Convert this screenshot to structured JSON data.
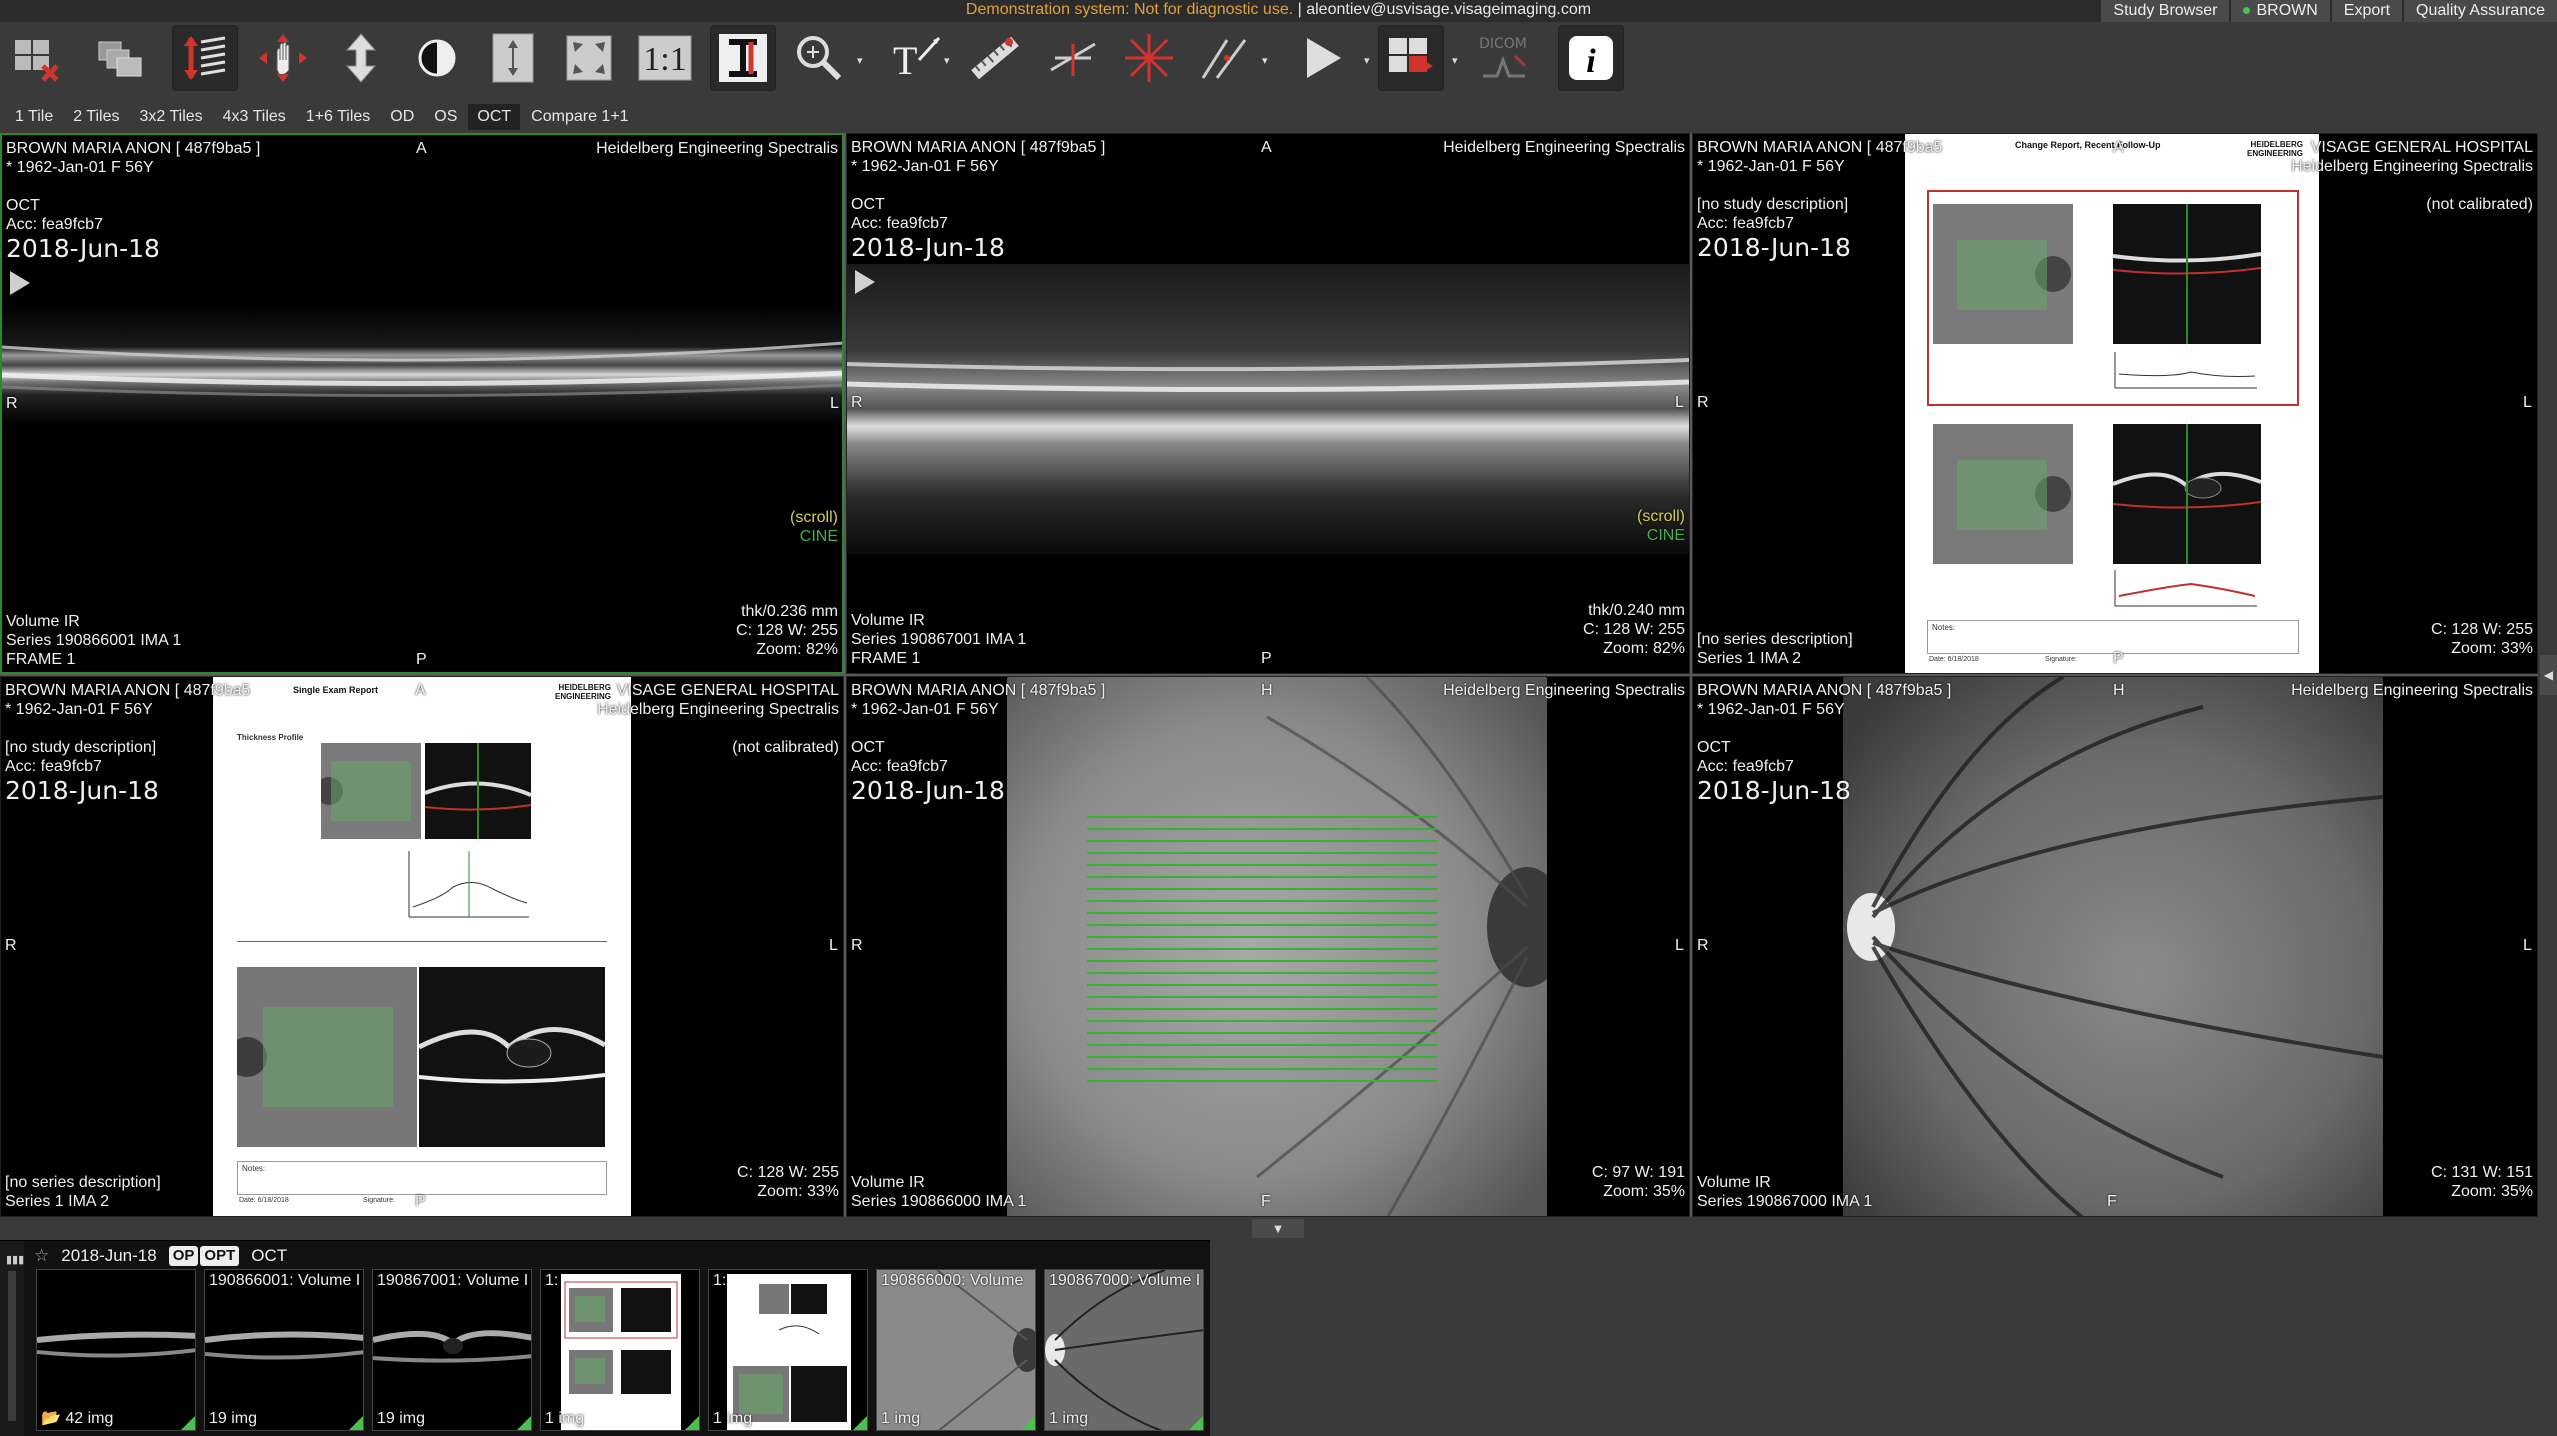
{
  "topbar": {
    "demo_notice": "Demonstration system: Not for diagnostic use.",
    "separator": " | ",
    "user_email": "aleontiev@usvisage.visageimaging.com",
    "menu": [
      "Study Browser",
      "BROWN",
      "Export",
      "Quality Assurance"
    ]
  },
  "toolbar": {
    "tools": [
      "layout-clear-icon",
      "series-stack-icon",
      "scroll-stack-icon",
      "pan-icon",
      "zoom-arrows-icon",
      "window-level-icon",
      "fit-vertical-icon",
      "fit-expand-icon",
      "one-to-one-icon",
      "invert-icon",
      "magnifier-icon",
      "annotation-text-icon",
      "ruler-icon",
      "angle-icon",
      "crosshair-icon",
      "line-tool-icon",
      "cine-play-icon",
      "hanging-protocol-icon",
      "dicom-icon",
      "info-icon"
    ],
    "one_to_one_label": "1:1",
    "dicom_label": "DICOM",
    "info_label": "i"
  },
  "layouts": [
    "1 Tile",
    "2 Tiles",
    "3x2 Tiles",
    "4x3 Tiles",
    "1+6 Tiles",
    "OD",
    "OS",
    "OCT",
    "Compare 1+1"
  ],
  "active_layout": "OCT",
  "viewports": [
    {
      "patient": "BROWN MARIA ANON [ 487f9ba5 ]",
      "dob": "* 1962-Jan-01 F 56Y",
      "orientation_top": "A",
      "device": "Heidelberg Engineering Spectralis",
      "modality": "OCT",
      "acc": "Acc: fea9fcb7",
      "date": "2018-Jun-18",
      "left": "R",
      "right": "L",
      "bottom_marker": "P",
      "scroll": "(scroll)",
      "cine": "CINE",
      "thickness": "thk/0.236 mm",
      "window": "C: 128 W: 255",
      "zoom": "Zoom: 82%",
      "series_desc": "Volume IR",
      "series": "Series 190866001 IMA 1",
      "frame": "FRAME 1"
    },
    {
      "patient": "BROWN MARIA ANON [ 487f9ba5 ]",
      "dob": "* 1962-Jan-01 F 56Y",
      "orientation_top": "A",
      "device": "Heidelberg Engineering Spectralis",
      "modality": "OCT",
      "acc": "Acc: fea9fcb7",
      "date": "2018-Jun-18",
      "left": "R",
      "right": "L",
      "bottom_marker": "P",
      "scroll": "(scroll)",
      "cine": "CINE",
      "thickness": "thk/0.240 mm",
      "window": "C: 128 W: 255",
      "zoom": "Zoom: 82%",
      "series_desc": "Volume IR",
      "series": "Series 190867001 IMA 1",
      "frame": "FRAME 1"
    },
    {
      "patient": "BROWN MARIA ANON [ 487f9ba5",
      "dob": "* 1962-Jan-01 F 56Y",
      "orientation_top": "A",
      "institution": "VISAGE GENERAL HOSPITAL",
      "device": "Heidelberg Engineering Spectralis",
      "calibration": "(not calibrated)",
      "study_desc": "[no study description]",
      "acc": "Acc: fea9fcb7",
      "date": "2018-Jun-18",
      "left": "R",
      "right": "L",
      "bottom_marker": "P",
      "window": "C: 128 W: 255",
      "zoom": "Zoom: 33%",
      "series_desc": "[no series description]",
      "series": "Series 1 IMA 2",
      "report_title": "Change Report, Recent Follow-Up",
      "report_brand": "HEIDELBERG ENGINEERING",
      "report_notes": "Notes:",
      "report_date": "Date: 6/18/2018",
      "report_signature": "Signature:"
    },
    {
      "patient": "BROWN MARIA ANON [ 487f9ba5",
      "dob": "* 1962-Jan-01 F 56Y",
      "orientation_top": "A",
      "institution": "VISAGE GENERAL HOSPITAL",
      "device": "Heidelberg Engineering Spectralis",
      "calibration": "(not calibrated)",
      "study_desc": "[no study description]",
      "acc": "Acc: fea9fcb7",
      "date": "2018-Jun-18",
      "left": "R",
      "right": "L",
      "bottom_marker": "P",
      "window": "C: 128 W: 255",
      "zoom": "Zoom: 33%",
      "series_desc": "[no series description]",
      "series": "Series 1 IMA 2",
      "report_title": "Single Exam Report",
      "report_brand": "HEIDELBERG ENGINEERING",
      "report_section": "Thickness Profile",
      "report_notes": "Notes:",
      "report_date": "Date: 6/18/2018",
      "report_signature": "Signature:"
    },
    {
      "patient": "BROWN MARIA ANON [ 487f9ba5 ]",
      "dob": "* 1962-Jan-01 F 56Y",
      "orientation_top": "H",
      "device": "Heidelberg Engineering Spectralis",
      "modality": "OCT",
      "acc": "Acc: fea9fcb7",
      "date": "2018-Jun-18",
      "left": "R",
      "right": "L",
      "bottom_marker": "F",
      "window": "C: 97 W: 191",
      "zoom": "Zoom: 35%",
      "series_desc": "Volume IR",
      "series": "Series 190866000 IMA 1"
    },
    {
      "patient": "BROWN MARIA ANON [ 487f9ba5 ]",
      "dob": "* 1962-Jan-01 F 56Y",
      "orientation_top": "H",
      "device": "Heidelberg Engineering Spectralis",
      "modality": "OCT",
      "acc": "Acc: fea9fcb7",
      "date": "2018-Jun-18",
      "left": "R",
      "right": "L",
      "bottom_marker": "F",
      "window": "C: 131 W: 151",
      "zoom": "Zoom: 35%",
      "series_desc": "Volume IR",
      "series": "Series 190867000 IMA 1"
    }
  ],
  "strip": {
    "study_date": "2018-Jun-18",
    "badges": [
      "OP",
      "OPT"
    ],
    "modality": "OCT",
    "thumbnails": [
      {
        "label": "",
        "count": "42 img",
        "folder": true
      },
      {
        "label": "190866001: Volume I",
        "count": "19 img"
      },
      {
        "label": "190867001: Volume I",
        "count": "19 img"
      },
      {
        "label": "1:",
        "count": "1 img"
      },
      {
        "label": "1:",
        "count": "1 img"
      },
      {
        "label": "190866000: Volume",
        "count": "1 img"
      },
      {
        "label": "190867000: Volume I",
        "count": "1 img"
      }
    ]
  }
}
